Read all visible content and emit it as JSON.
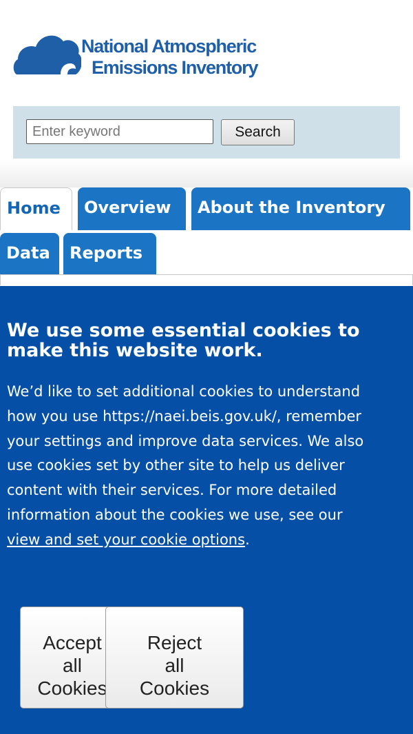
{
  "header": {
    "logo_line1": "National Atmospheric",
    "logo_line2": "Emissions Inventory",
    "brand_color": "#1f5fa8"
  },
  "search": {
    "placeholder": "Enter keyword",
    "value": "",
    "button_label": "Search"
  },
  "nav": {
    "tabs": [
      {
        "label": "Home",
        "active": true
      },
      {
        "label": "Overview",
        "active": false
      },
      {
        "label": "About the Inventory",
        "active": false
      },
      {
        "label": "Data",
        "active": false
      },
      {
        "label": "Reports",
        "active": false
      }
    ],
    "tab_color": "#1b75c4"
  },
  "cookie_banner": {
    "background": "#0550a6",
    "heading_line1": "We use some essential cookies to",
    "heading_line2": "make this website work.",
    "body_lines": [
      "We’d like to set additional cookies to understand",
      "how you use https://naei.beis.gov.uk/, remember",
      "your settings and improve data services. We also",
      "use cookies set by other site to help us deliver",
      "content with their services. For more detailed",
      "information about the cookies we use, see our"
    ],
    "link_text": "view and set your cookie options",
    "link_suffix": ".",
    "accept_line1": "Accept",
    "accept_line2": "all",
    "accept_line3": "Cookies",
    "reject_line1": "Reject",
    "reject_line2": "all",
    "reject_line3": "Cookies"
  }
}
